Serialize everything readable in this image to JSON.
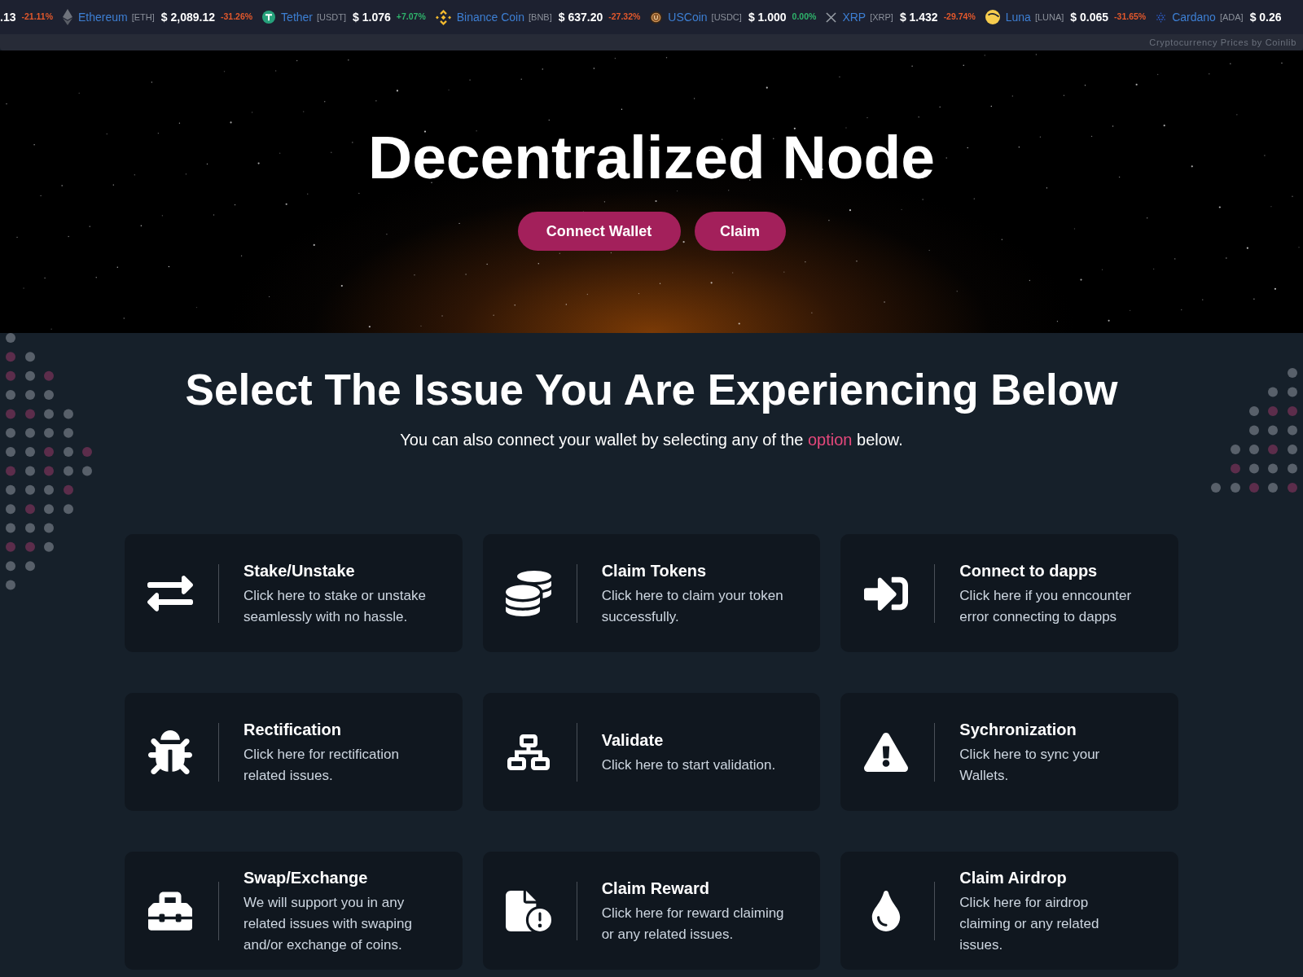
{
  "ticker": {
    "items": [
      {
        "price": ".13",
        "change": "-21.11%",
        "color": "#e2582c"
      },
      {
        "name": "Ethereum",
        "symbol": "[ETH]",
        "price": "$ 2,089.12",
        "change": "-31.26%",
        "color": "#e2582c"
      },
      {
        "name": "Tether",
        "symbol": "[USDT]",
        "price": "$ 1.076",
        "change": "+7.07%",
        "color": "#2fb36b"
      },
      {
        "name": "Binance Coin",
        "symbol": "[BNB]",
        "price": "$ 637.20",
        "change": "-27.32%",
        "color": "#e2582c"
      },
      {
        "name": "USCoin",
        "symbol": "[USDC]",
        "price": "$ 1.000",
        "change": "0.00%",
        "color": "#2fb36b"
      },
      {
        "name": "XRP",
        "symbol": "[XRP]",
        "price": "$ 1.432",
        "change": "-29.74%",
        "color": "#e2582c"
      },
      {
        "name": "Luna",
        "symbol": "[LUNA]",
        "price": "$ 0.065",
        "change": "-31.65%",
        "color": "#e2582c"
      },
      {
        "name": "Cardano",
        "symbol": "[ADA]",
        "price": "$ 0.26"
      }
    ],
    "attribution": "Cryptocurrency Prices by Coinlib"
  },
  "hero": {
    "title": "Decentralized Node",
    "buttons": [
      "Connect Wallet",
      "Claim"
    ]
  },
  "issues": {
    "heading": "Select The Issue You Are Experiencing Below",
    "subtitle": {
      "before": "You can also connect your wallet by selecting any of the ",
      "link": "option",
      "after": " below."
    },
    "cards": [
      {
        "title": "Stake/Unstake",
        "description_lines": [
          "Click here to stake or unstake",
          "seamlessly with no hassle."
        ]
      },
      {
        "title": "Claim Tokens",
        "description_lines": [
          "Click here to claim your token",
          "successfully."
        ]
      },
      {
        "title": "Connect to dapps",
        "description_lines": [
          "Click here if you enncounter",
          "error connecting to dapps"
        ]
      },
      {
        "title": "Rectification",
        "description_lines": [
          "Click here for rectification",
          "related issues."
        ]
      },
      {
        "title": "Validate",
        "description_lines": [
          "Click here to start validation."
        ]
      },
      {
        "title": "Sychronization",
        "description_lines": [
          "Click here to sync your",
          "Wallets."
        ]
      },
      {
        "title": "Swap/Exchange",
        "description_lines": [
          "We will support you in any",
          "related issues with swaping",
          "and/or exchange of coins."
        ]
      },
      {
        "title": "Claim Reward",
        "description_lines": [
          "Click here for reward claiming",
          "or any related issues."
        ]
      },
      {
        "title": "Claim Airdrop",
        "description_lines": [
          "Click here for airdrop",
          "claiming or any related",
          "issues."
        ]
      }
    ]
  }
}
